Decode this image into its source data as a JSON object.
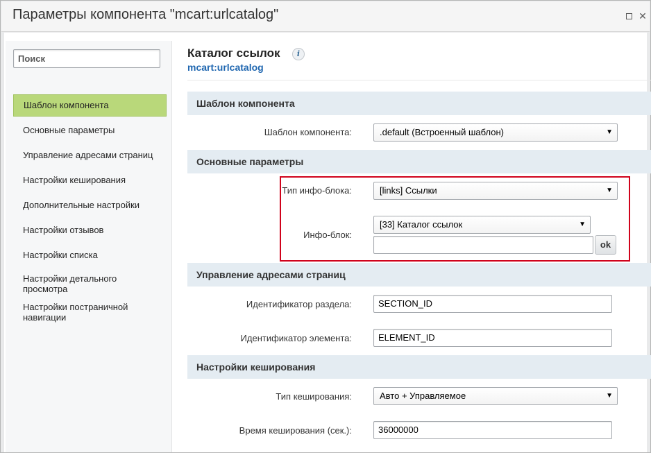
{
  "window": {
    "title": "Параметры компонента \"mcart:urlcatalog\""
  },
  "sidebar": {
    "search_placeholder": "Поиск",
    "items": [
      {
        "label": "Шаблон компонента",
        "active": true
      },
      {
        "label": "Основные параметры"
      },
      {
        "label": "Управление адресами страниц"
      },
      {
        "label": "Настройки кеширования"
      },
      {
        "label": "Дополнительные настройки"
      },
      {
        "label": "Настройки отзывов"
      },
      {
        "label": "Настройки списка"
      },
      {
        "label": "Настройки детального просмотра"
      },
      {
        "label": "Настройки постраничной навигации"
      }
    ]
  },
  "main": {
    "title": "Каталог ссылок",
    "subtitle": "mcart:urlcatalog",
    "info_icon": "i",
    "sections": {
      "template": {
        "header": "Шаблон компонента",
        "template_label": "Шаблон компонента:",
        "template_value": ".default (Встроенный шаблон)"
      },
      "basic": {
        "header": "Основные параметры",
        "iblock_type_label": "Тип инфо-блока:",
        "iblock_type_value": "[links] Ссылки",
        "iblock_label": "Инфо-блок:",
        "iblock_value": "[33] Каталог ссылок",
        "iblock_custom_value": "",
        "ok_label": "ok"
      },
      "sef": {
        "header": "Управление адресами страниц",
        "section_id_label": "Идентификатор раздела:",
        "section_id_value": "SECTION_ID",
        "element_id_label": "Идентификатор элемента:",
        "element_id_value": "ELEMENT_ID"
      },
      "cache": {
        "header": "Настройки кеширования",
        "cache_type_label": "Тип кеширования:",
        "cache_type_value": "Авто + Управляемое",
        "cache_time_label": "Время кеширования (сек.):",
        "cache_time_value": "36000000"
      }
    }
  },
  "colors": {
    "active_item": "#b9d87a",
    "section_header": "#e4ecf2",
    "subtitle": "#2067b0",
    "highlight": "#d0021b"
  }
}
